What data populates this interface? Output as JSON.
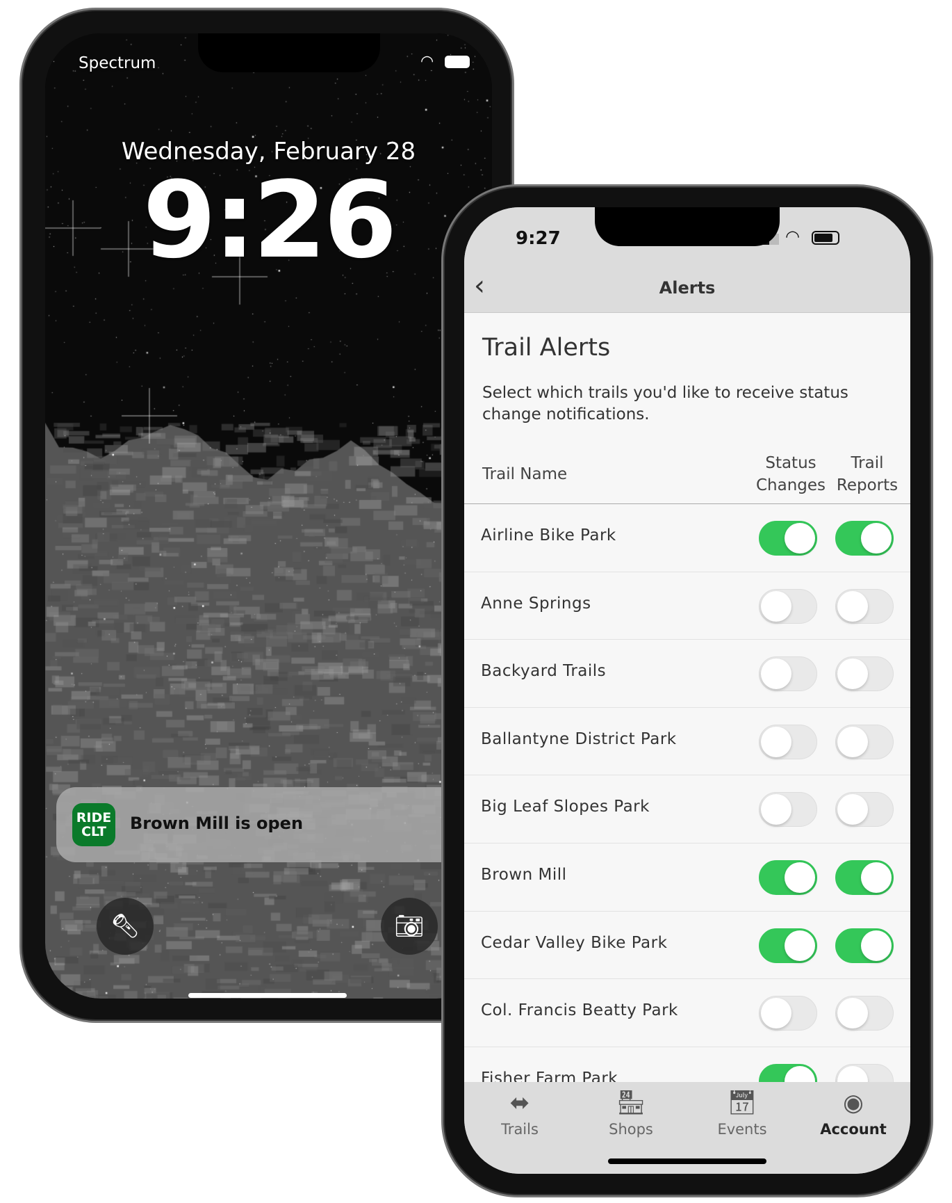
{
  "lock_screen": {
    "carrier": "Spectrum",
    "date": "Wednesday, February 28",
    "time": "9:26",
    "notification": {
      "app_icon_text": [
        "RIDE",
        "CLT"
      ],
      "message": "Brown Mill is open",
      "brand_color": "#0a7a2a"
    },
    "icons": [
      "flashlight-icon",
      "camera-icon"
    ]
  },
  "app": {
    "status_time": "9:27",
    "nav_title": "Alerts",
    "heading": "Trail Alerts",
    "description": "Select which trails you'd like to receive status change notifications.",
    "columns": {
      "name": "Trail Name",
      "status": [
        "Status",
        "Changes"
      ],
      "reports": [
        "Trail",
        "Reports"
      ]
    },
    "accent": "#34c759",
    "trails": [
      {
        "name": "Airline Bike Park",
        "status_changes": true,
        "trail_reports": true
      },
      {
        "name": "Anne Springs",
        "status_changes": false,
        "trail_reports": false
      },
      {
        "name": "Backyard Trails",
        "status_changes": false,
        "trail_reports": false
      },
      {
        "name": "Ballantyne District Park",
        "status_changes": false,
        "trail_reports": false
      },
      {
        "name": "Big Leaf Slopes Park",
        "status_changes": false,
        "trail_reports": false
      },
      {
        "name": "Brown Mill",
        "status_changes": true,
        "trail_reports": true
      },
      {
        "name": "Cedar Valley Bike Park",
        "status_changes": true,
        "trail_reports": true
      },
      {
        "name": "Col. Francis Beatty Park",
        "status_changes": false,
        "trail_reports": false
      },
      {
        "name": "Fisher Farm Park",
        "status_changes": true,
        "trail_reports": false
      }
    ],
    "tabs": [
      {
        "label": "Trails",
        "icon": "signpost-icon"
      },
      {
        "label": "Shops",
        "icon": "storefront-icon"
      },
      {
        "label": "Events",
        "icon": "calendar-icon"
      },
      {
        "label": "Account",
        "icon": "account-icon",
        "active": true
      }
    ]
  }
}
